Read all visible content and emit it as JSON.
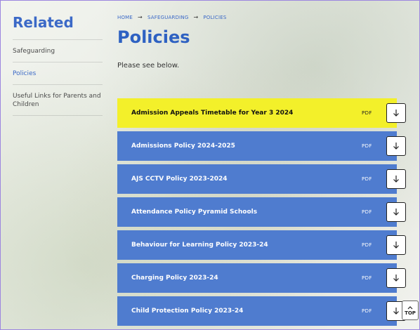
{
  "sidebar": {
    "heading": "Related",
    "items": [
      {
        "label": "Safeguarding"
      },
      {
        "label": "Policies"
      },
      {
        "label": "Useful Links for Parents and Children"
      }
    ]
  },
  "breadcrumb": {
    "items": [
      "HOME",
      "SAFEGUARDING",
      "POLICIES"
    ],
    "separator": "→"
  },
  "page": {
    "title": "Policies",
    "intro": "Please see below."
  },
  "documents": [
    {
      "title": "Admission Appeals Timetable for Year 3 2024",
      "format": "PDF"
    },
    {
      "title": "Admissions Policy 2024-2025",
      "format": "PDF"
    },
    {
      "title": "AJS CCTV Policy 2023-2024",
      "format": "PDF"
    },
    {
      "title": "Attendance Policy Pyramid Schools",
      "format": "PDF"
    },
    {
      "title": "Behaviour for Learning Policy 2023-24",
      "format": "PDF"
    },
    {
      "title": "Charging Policy 2023-24",
      "format": "PDF"
    },
    {
      "title": "Child Protection Policy 2023-24",
      "format": "PDF"
    }
  ],
  "back_to_top": {
    "label": "TOP",
    "icon": "chevron-up-icon"
  },
  "colors": {
    "brand_blue": "#2e61c2",
    "row_blue": "#4f7ccf",
    "highlight_yellow": "#f3f02a"
  }
}
